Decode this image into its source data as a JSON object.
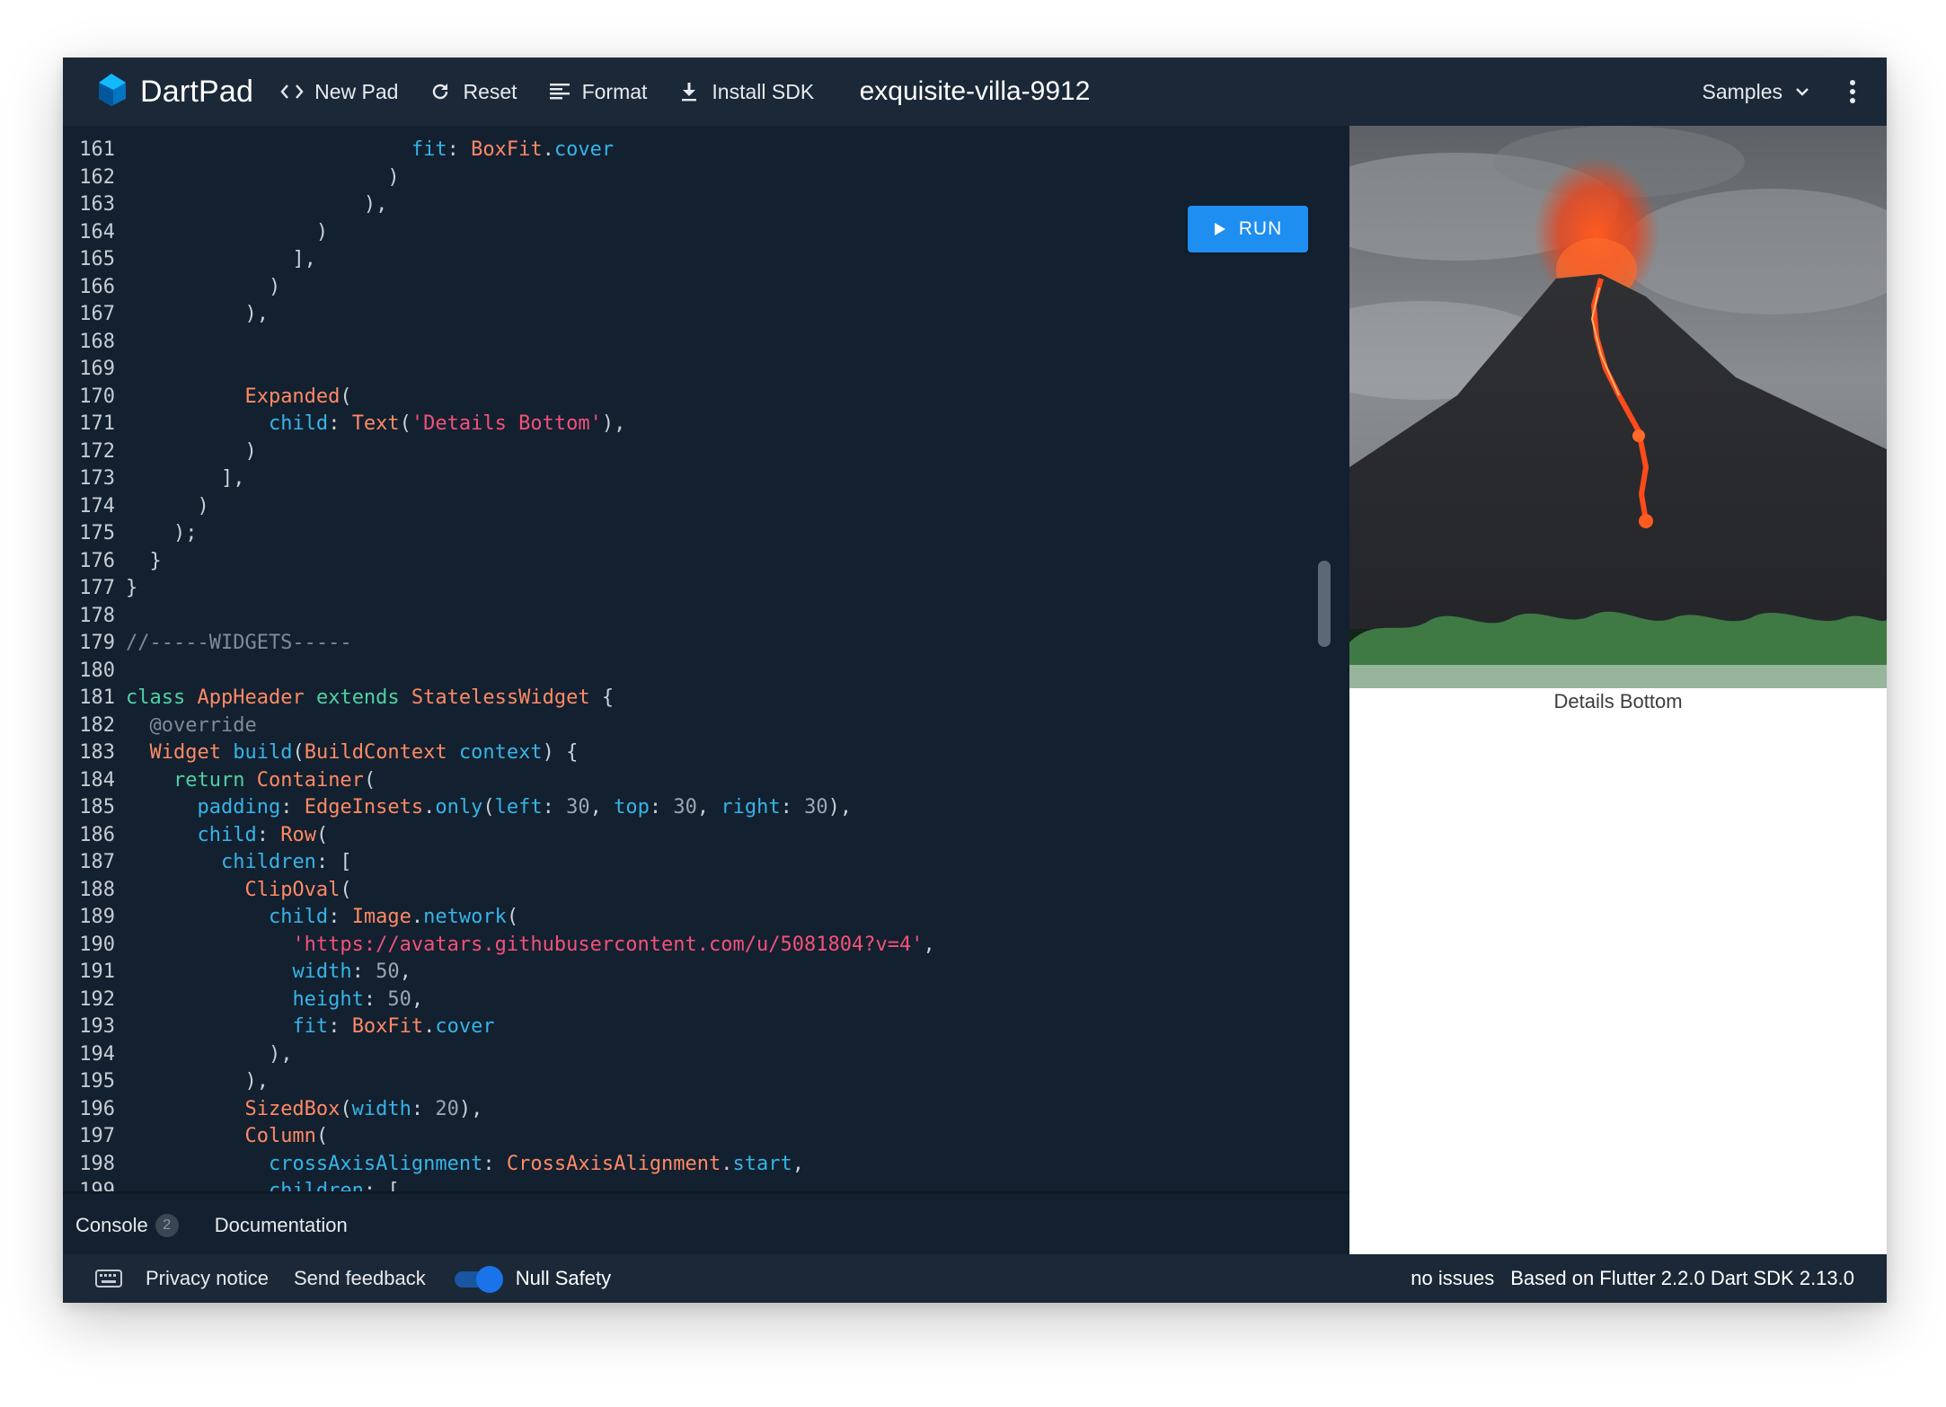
{
  "app": {
    "name": "DartPad",
    "pad_title": "exquisite-villa-9912"
  },
  "toolbar": {
    "new_pad": "New Pad",
    "reset": "Reset",
    "format": "Format",
    "install_sdk": "Install SDK",
    "samples": "Samples"
  },
  "editor": {
    "run_label": "RUN",
    "lines": [
      {
        "n": "161",
        "indent": 12,
        "tokens": [
          [
            "p",
            "fit"
          ],
          [
            "",
            "': '"
          ],
          [
            "t",
            "BoxFit"
          ],
          [
            "",
            "."
          ],
          [
            "p",
            "cover"
          ]
        ]
      },
      {
        "n": "162",
        "indent": 11,
        "tokens": [
          [
            "",
            ")"
          ]
        ]
      },
      {
        "n": "163",
        "indent": 10,
        "tokens": [
          [
            "",
            "),"
          ]
        ]
      },
      {
        "n": "164",
        "indent": 8,
        "tokens": [
          [
            "",
            ")"
          ]
        ]
      },
      {
        "n": "165",
        "indent": 7,
        "tokens": [
          [
            "",
            "],"
          ]
        ]
      },
      {
        "n": "166",
        "indent": 6,
        "tokens": [
          [
            "",
            ")"
          ]
        ]
      },
      {
        "n": "167",
        "indent": 5,
        "tokens": [
          [
            "",
            "),"
          ]
        ]
      },
      {
        "n": "168",
        "indent": 0,
        "tokens": []
      },
      {
        "n": "169",
        "indent": 0,
        "tokens": []
      },
      {
        "n": "170",
        "indent": 5,
        "tokens": [
          [
            "t",
            "Expanded"
          ],
          [
            "",
            "("
          ]
        ]
      },
      {
        "n": "171",
        "indent": 6,
        "tokens": [
          [
            "p",
            "child"
          ],
          [
            "",
            ": "
          ],
          [
            "t",
            "Text"
          ],
          [
            "",
            "("
          ],
          [
            "s",
            "'Details Bottom'"
          ],
          [
            "",
            "),"
          ]
        ]
      },
      {
        "n": "172",
        "indent": 5,
        "tokens": [
          [
            "",
            ")"
          ]
        ]
      },
      {
        "n": "173",
        "indent": 4,
        "tokens": [
          [
            "",
            "],"
          ]
        ]
      },
      {
        "n": "174",
        "indent": 3,
        "tokens": [
          [
            "",
            ")"
          ]
        ]
      },
      {
        "n": "175",
        "indent": 2,
        "tokens": [
          [
            "",
            ");"
          ]
        ]
      },
      {
        "n": "176",
        "indent": 1,
        "tokens": [
          [
            "",
            "}"
          ]
        ]
      },
      {
        "n": "177",
        "indent": 0,
        "tokens": [
          [
            "",
            "}"
          ]
        ]
      },
      {
        "n": "178",
        "indent": 0,
        "tokens": []
      },
      {
        "n": "179",
        "indent": 0,
        "tokens": [
          [
            "c",
            "//-----WIDGETS-----"
          ]
        ]
      },
      {
        "n": "180",
        "indent": 0,
        "tokens": []
      },
      {
        "n": "181",
        "indent": 0,
        "tokens": [
          [
            "k",
            "class"
          ],
          [
            "",
            " "
          ],
          [
            "t",
            "AppHeader"
          ],
          [
            "",
            " "
          ],
          [
            "k",
            "extends"
          ],
          [
            "",
            " "
          ],
          [
            "t",
            "StatelessWidget"
          ],
          [
            "",
            " {"
          ]
        ]
      },
      {
        "n": "182",
        "indent": 1,
        "tokens": [
          [
            "c",
            "@override"
          ]
        ]
      },
      {
        "n": "183",
        "indent": 1,
        "tokens": [
          [
            "t",
            "Widget"
          ],
          [
            "",
            " "
          ],
          [
            "p",
            "build"
          ],
          [
            "",
            "("
          ],
          [
            "t",
            "BuildContext"
          ],
          [
            "",
            " "
          ],
          [
            "p",
            "context"
          ],
          [
            "",
            ") {"
          ]
        ]
      },
      {
        "n": "184",
        "indent": 2,
        "tokens": [
          [
            "k",
            "return"
          ],
          [
            "",
            " "
          ],
          [
            "t",
            "Container"
          ],
          [
            "",
            "("
          ]
        ]
      },
      {
        "n": "185",
        "indent": 3,
        "tokens": [
          [
            "p",
            "padding"
          ],
          [
            "",
            ": "
          ],
          [
            "t",
            "EdgeInsets"
          ],
          [
            "",
            "."
          ],
          [
            "p",
            "only"
          ],
          [
            "",
            "("
          ],
          [
            "p",
            "left"
          ],
          [
            "",
            ": "
          ],
          [
            "n",
            "30"
          ],
          [
            "",
            ", "
          ],
          [
            "p",
            "top"
          ],
          [
            "",
            ": "
          ],
          [
            "n",
            "30"
          ],
          [
            "",
            ", "
          ],
          [
            "p",
            "right"
          ],
          [
            "",
            ": "
          ],
          [
            "n",
            "30"
          ],
          [
            "",
            "),"
          ]
        ]
      },
      {
        "n": "186",
        "indent": 3,
        "tokens": [
          [
            "p",
            "child"
          ],
          [
            "",
            ": "
          ],
          [
            "t",
            "Row"
          ],
          [
            "",
            "("
          ]
        ]
      },
      {
        "n": "187",
        "indent": 4,
        "tokens": [
          [
            "p",
            "children"
          ],
          [
            "",
            ": ["
          ]
        ]
      },
      {
        "n": "188",
        "indent": 5,
        "tokens": [
          [
            "t",
            "ClipOval"
          ],
          [
            "",
            "("
          ]
        ]
      },
      {
        "n": "189",
        "indent": 6,
        "tokens": [
          [
            "p",
            "child"
          ],
          [
            "",
            ": "
          ],
          [
            "t",
            "Image"
          ],
          [
            "",
            "."
          ],
          [
            "p",
            "network"
          ],
          [
            "",
            "("
          ]
        ]
      },
      {
        "n": "190",
        "indent": 7,
        "tokens": [
          [
            "s",
            "'https://avatars.githubusercontent.com/u/5081804?v=4'"
          ],
          [
            "",
            ","
          ]
        ]
      },
      {
        "n": "191",
        "indent": 7,
        "tokens": [
          [
            "p",
            "width"
          ],
          [
            "",
            ": "
          ],
          [
            "n",
            "50"
          ],
          [
            "",
            ","
          ]
        ]
      },
      {
        "n": "192",
        "indent": 7,
        "tokens": [
          [
            "p",
            "height"
          ],
          [
            "",
            ": "
          ],
          [
            "n",
            "50"
          ],
          [
            "",
            ","
          ]
        ]
      },
      {
        "n": "193",
        "indent": 7,
        "tokens": [
          [
            "p",
            "fit"
          ],
          [
            "",
            ": "
          ],
          [
            "t",
            "BoxFit"
          ],
          [
            "",
            "."
          ],
          [
            "p",
            "cover"
          ]
        ]
      },
      {
        "n": "194",
        "indent": 6,
        "tokens": [
          [
            "",
            "),"
          ]
        ]
      },
      {
        "n": "195",
        "indent": 5,
        "tokens": [
          [
            "",
            "),"
          ]
        ]
      },
      {
        "n": "196",
        "indent": 5,
        "tokens": [
          [
            "t",
            "SizedBox"
          ],
          [
            "",
            "("
          ],
          [
            "p",
            "width"
          ],
          [
            "",
            ": "
          ],
          [
            "n",
            "20"
          ],
          [
            "",
            "),"
          ]
        ]
      },
      {
        "n": "197",
        "indent": 5,
        "tokens": [
          [
            "t",
            "Column"
          ],
          [
            "",
            "("
          ]
        ]
      },
      {
        "n": "198",
        "indent": 6,
        "tokens": [
          [
            "p",
            "crossAxisAlignment"
          ],
          [
            "",
            ": "
          ],
          [
            "t",
            "CrossAxisAlignment"
          ],
          [
            "",
            "."
          ],
          [
            "p",
            "start"
          ],
          [
            "",
            ","
          ]
        ]
      },
      {
        "n": "199",
        "indent": 6,
        "tokens": [
          [
            "p",
            "children"
          ],
          [
            "",
            ": ["
          ]
        ]
      }
    ]
  },
  "output": {
    "details_text": "Details Bottom"
  },
  "console": {
    "tab_console": "Console",
    "console_count": "2",
    "tab_documentation": "Documentation"
  },
  "statusbar": {
    "privacy": "Privacy notice",
    "feedback": "Send feedback",
    "null_safety": "Null Safety",
    "issues": "no issues",
    "version": "Based on Flutter 2.2.0 Dart SDK 2.13.0"
  },
  "colors": {
    "background": "#13202f",
    "bar": "#1b2838",
    "accent": "#1f8ef1"
  }
}
